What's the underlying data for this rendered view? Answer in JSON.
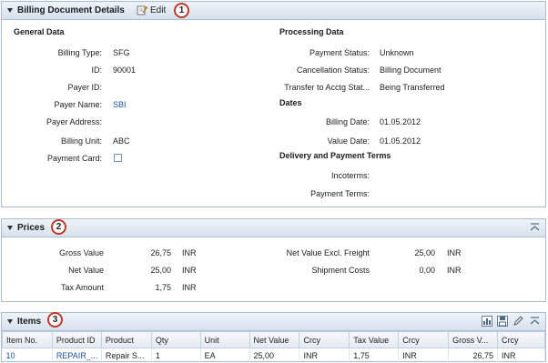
{
  "billing_panel": {
    "title": "Billing Document Details",
    "edit_label": "Edit",
    "badge": "1",
    "general": {
      "title": "General Data",
      "fields": [
        {
          "label": "Billing Type:",
          "value": "SFG"
        },
        {
          "label": "ID:",
          "value": "90001"
        },
        {
          "label": "Payer ID:",
          "value": ""
        },
        {
          "label": "Payer Name:",
          "value": "SBI"
        },
        {
          "label": "Payer Address:",
          "value": ""
        },
        {
          "label": "Billing Unit:",
          "value": "ABC"
        },
        {
          "label": "Payment Card:",
          "value": ""
        }
      ]
    },
    "processing": {
      "title": "Processing Data",
      "fields": [
        {
          "label": "Payment Status:",
          "value": "Unknown"
        },
        {
          "label": "Cancellation Status:",
          "value": "Billing Document"
        },
        {
          "label": "Transfer to Acctg Stat...",
          "value": "Being Transferred"
        }
      ]
    },
    "dates": {
      "title": "Dates",
      "fields": [
        {
          "label": "Billing Date:",
          "value": "01.05.2012"
        },
        {
          "label": "Value Date:",
          "value": "01.05.2012"
        }
      ]
    },
    "delivery": {
      "title": "Delivery and Payment Terms",
      "fields": [
        {
          "label": "Incoterms:",
          "value": ""
        },
        {
          "label": "Payment Terms:",
          "value": ""
        }
      ]
    }
  },
  "prices_panel": {
    "title": "Prices",
    "badge": "2",
    "left": [
      {
        "label": "Gross Value",
        "value": "26,75",
        "currency": "INR"
      },
      {
        "label": "Net Value",
        "value": "25,00",
        "currency": "INR"
      },
      {
        "label": "Tax Amount",
        "value": "1,75",
        "currency": "INR"
      }
    ],
    "right": [
      {
        "label": "Net Value Excl. Freight",
        "value": "25,00",
        "currency": "INR"
      },
      {
        "label": "Shipment Costs",
        "value": "0,00",
        "currency": "INR"
      }
    ]
  },
  "items_panel": {
    "title": "Items",
    "badge": "3",
    "columns": [
      "Item No.",
      "Product ID",
      "Product",
      "Qty",
      "Unit",
      "Net Value",
      "Crcy",
      "Tax Value",
      "Crcy",
      "Gross V...",
      "Crcy"
    ],
    "rows": [
      [
        "10",
        "REPAIR_...",
        "Repair S...",
        "1",
        "EA",
        "25,00",
        "INR",
        "1,75",
        "INR",
        "26,75",
        "INR"
      ]
    ]
  },
  "colors": {
    "link": "#1a4f9c",
    "badge_border": "#c0392b",
    "panel_border": "#a9bcd0"
  },
  "icons": [
    "triangle-down-icon",
    "edit-icon",
    "collapse-icon",
    "export-icon",
    "save-icon",
    "pencil-icon"
  ]
}
